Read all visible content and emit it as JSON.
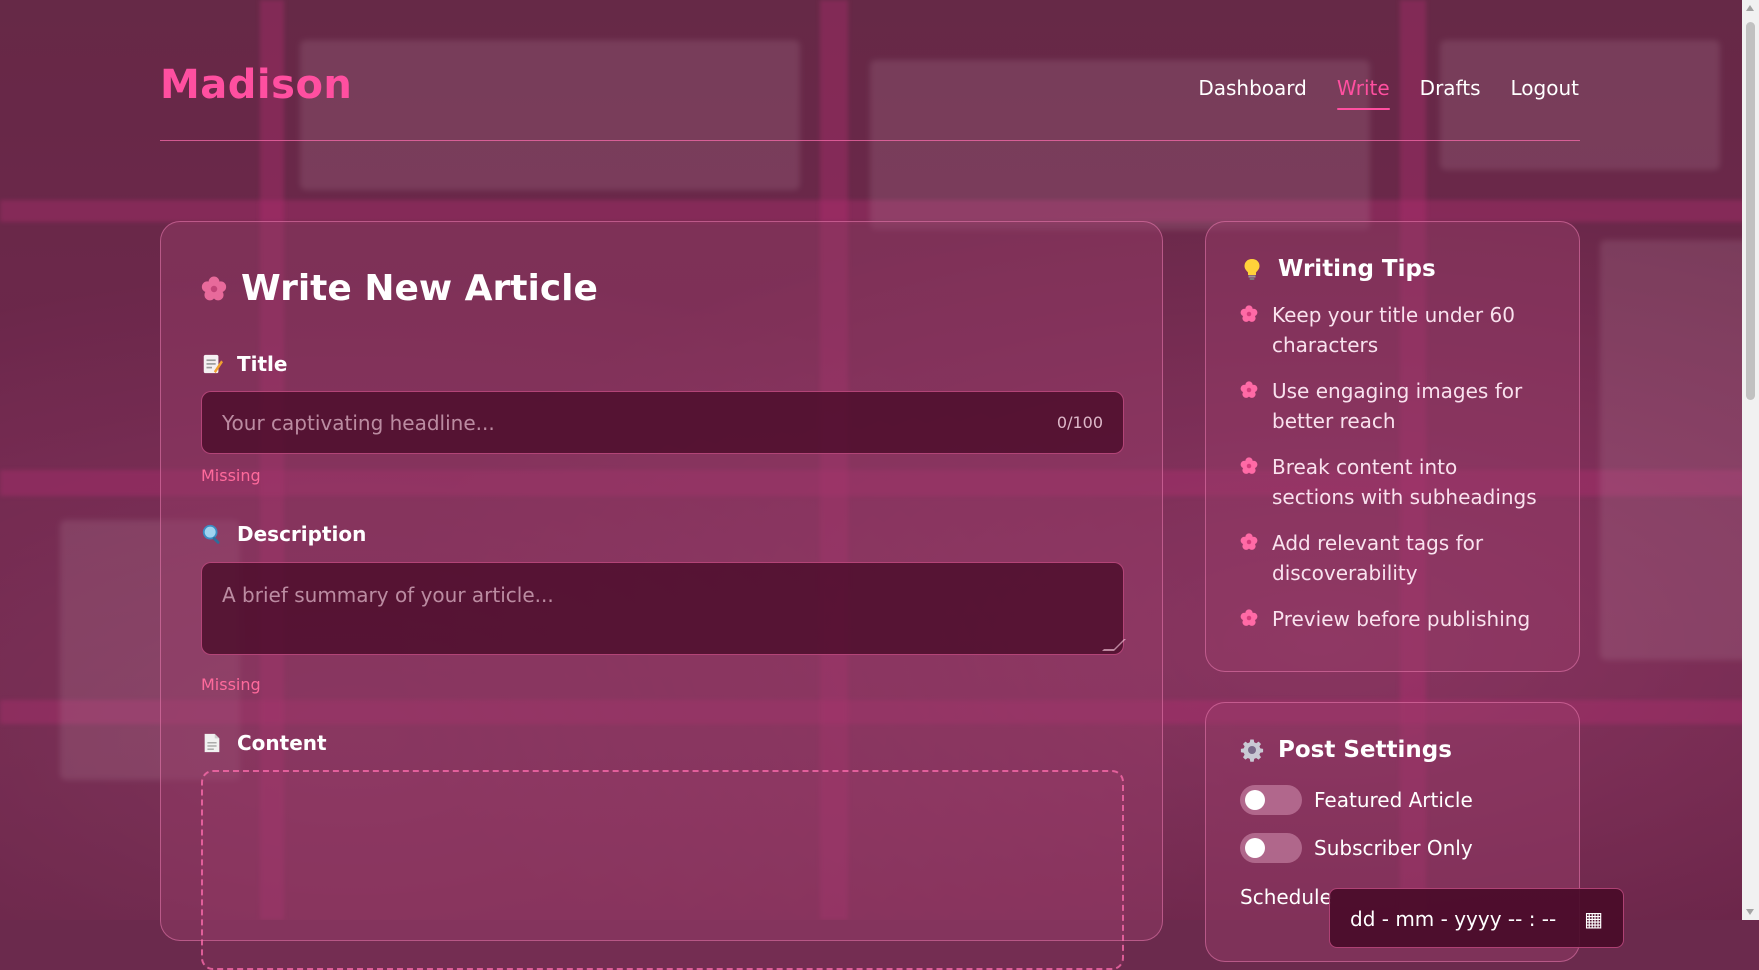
{
  "brand": {
    "name": "Madison",
    "accent": "#ff4fa0"
  },
  "nav": {
    "items": [
      {
        "label": "Dashboard",
        "active": false
      },
      {
        "label": "Write",
        "active": true
      },
      {
        "label": "Drafts",
        "active": false
      },
      {
        "label": "Logout",
        "active": false
      }
    ]
  },
  "editor": {
    "heading": "Write New Article",
    "heading_icon": "flower-icon",
    "title": {
      "label": "Title",
      "icon": "memo-icon",
      "placeholder": "Your captivating headline...",
      "value": "",
      "counter": "0/100",
      "validation": "Missing"
    },
    "description": {
      "label": "Description",
      "icon": "magnifier-icon",
      "placeholder": "A brief summary of your article...",
      "value": "",
      "validation": "Missing"
    },
    "content": {
      "label": "Content",
      "icon": "page-icon"
    }
  },
  "tips": {
    "heading": "Writing Tips",
    "icon": "lightbulb-icon",
    "items": [
      "Keep your title under 60 characters",
      "Use engaging images for better reach",
      "Break content into sections with subheadings",
      "Add relevant tags for discoverability",
      "Preview before publishing"
    ]
  },
  "settings": {
    "heading": "Post Settings",
    "icon": "gear-icon",
    "toggles": [
      {
        "label": "Featured Article",
        "on": false
      },
      {
        "label": "Subscriber Only",
        "on": false
      }
    ],
    "schedule_label": "Schedule",
    "date_placeholder": "dd - mm - yyyy   -- : --"
  }
}
